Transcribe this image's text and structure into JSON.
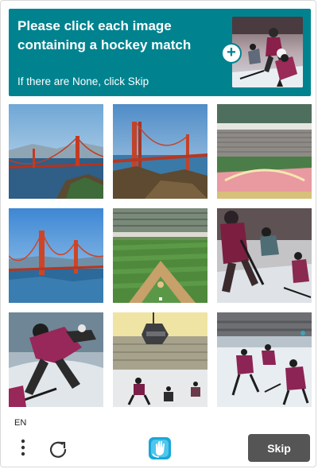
{
  "header": {
    "prompt": "Please click each image containing a hockey match",
    "subprompt": "If there are None, click Skip",
    "example_image": "hockey-players-image",
    "expand_icon": "plus-icon"
  },
  "grid": {
    "tiles": [
      {
        "subject": "golden-gate-bridge"
      },
      {
        "subject": "golden-gate-bridge"
      },
      {
        "subject": "baseball-stadium"
      },
      {
        "subject": "golden-gate-bridge"
      },
      {
        "subject": "baseball-field"
      },
      {
        "subject": "hockey-players"
      },
      {
        "subject": "hockey-player"
      },
      {
        "subject": "hockey-arena"
      },
      {
        "subject": "hockey-players"
      }
    ]
  },
  "footer": {
    "language": "EN",
    "menu_icon": "kebab-menu-icon",
    "refresh_icon": "refresh-icon",
    "logo_icon": "hand-logo-icon",
    "skip_label": "Skip"
  },
  "colors": {
    "accent": "#00838f",
    "skip_button": "#555555"
  }
}
